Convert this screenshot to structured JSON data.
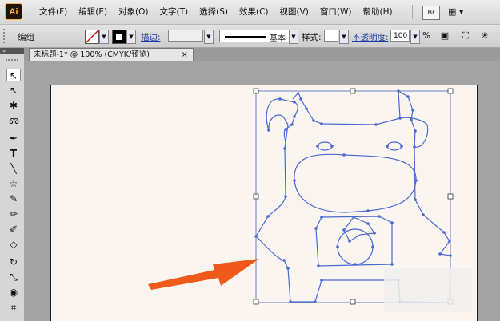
{
  "app": {
    "logo": "Ai"
  },
  "menu": [
    "文件(F)",
    "编辑(E)",
    "对象(O)",
    "文字(T)",
    "选择(S)",
    "效果(C)",
    "视图(V)",
    "窗口(W)",
    "帮助(H)"
  ],
  "menu_right": {
    "bridge_label": "Br",
    "arrange_icon": "arrange-documents-icon"
  },
  "control_bar": {
    "mode_label": "编组",
    "stroke_link": "描边:",
    "stroke_style": "基本",
    "style_label": "样式:",
    "opacity_link": "不透明度:",
    "opacity_value": "100",
    "opacity_unit": "%"
  },
  "document_tab": {
    "title": "未标题-1* @ 100% (CMYK/预览)",
    "close": "×"
  },
  "tools": [
    {
      "name": "selection-tool-icon",
      "glyph": "↖"
    },
    {
      "name": "direct-selection-tool-icon",
      "glyph": "↖"
    },
    {
      "name": "magic-wand-tool-icon",
      "glyph": "✱"
    },
    {
      "name": "lasso-tool-icon",
      "glyph": "ഌ"
    },
    {
      "name": "pen-tool-icon",
      "glyph": "✒"
    },
    {
      "name": "type-tool-icon",
      "glyph": "T"
    },
    {
      "name": "line-tool-icon",
      "glyph": "╲"
    },
    {
      "name": "star-tool-icon",
      "glyph": "☆"
    },
    {
      "name": "brush-tool-icon",
      "glyph": "✎"
    },
    {
      "name": "pencil-tool-icon",
      "glyph": "✏"
    },
    {
      "name": "blob-brush-tool-icon",
      "glyph": "✐"
    },
    {
      "name": "eraser-tool-icon",
      "glyph": "◇"
    },
    {
      "name": "rotate-tool-icon",
      "glyph": "↻"
    },
    {
      "name": "scale-tool-icon",
      "glyph": "⤡"
    },
    {
      "name": "warp-tool-icon",
      "glyph": "◉"
    },
    {
      "name": "free-transform-tool-icon",
      "glyph": "⌗"
    }
  ],
  "colors": {
    "path_blue": "#4a6ad0",
    "arrow_orange": "#ef5a1b",
    "artboard_bg": "#fbf5f2"
  }
}
